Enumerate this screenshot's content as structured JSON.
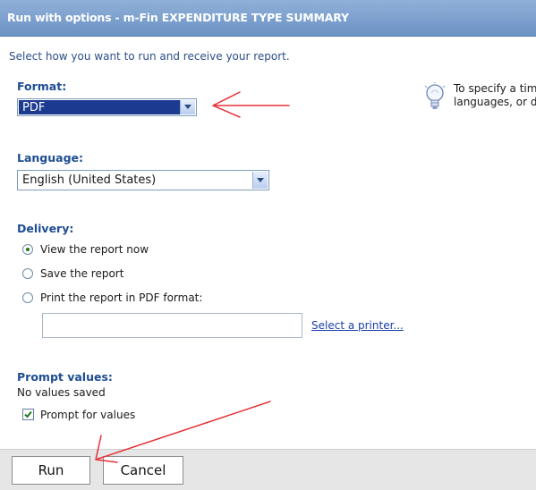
{
  "window": {
    "title": "Run with options - m-Fin EXPENDITURE TYPE SUMMARY"
  },
  "subtitle": "Select how you want to run and receive your report.",
  "format": {
    "label": "Format:",
    "value": "PDF"
  },
  "tip": {
    "line1": "To specify a tim",
    "line2": "languages, or d"
  },
  "language": {
    "label": "Language:",
    "value": "English (United States)"
  },
  "delivery": {
    "label": "Delivery:",
    "options": [
      {
        "label": "View the report now",
        "checked": true
      },
      {
        "label": "Save the report",
        "checked": false
      },
      {
        "label": "Print the report in PDF format:",
        "checked": false
      }
    ],
    "printer_value": "",
    "printer_link": "Select a printer..."
  },
  "prompt": {
    "label": "Prompt values:",
    "status": "No values saved",
    "checkbox_label": "Prompt for values",
    "checkbox_checked": true
  },
  "buttons": {
    "run": "Run",
    "cancel": "Cancel"
  },
  "colors": {
    "title_bar": "#6c92c5",
    "section_label": "#1d4d93",
    "format_selected_bg": "#1c3a8f",
    "annotation_arrow": "#e8323a"
  }
}
